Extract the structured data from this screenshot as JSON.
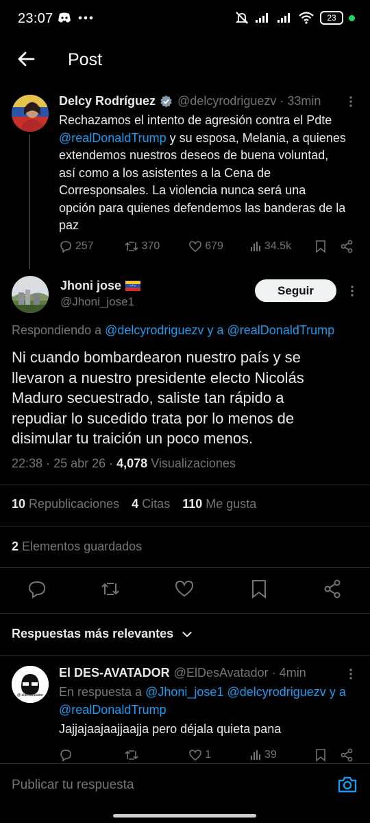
{
  "status_bar": {
    "time": "23:07",
    "battery": "23"
  },
  "header": {
    "title": "Post"
  },
  "parent_tweet": {
    "name": "Delcy Rodríguez",
    "handle": "@delcyrodriguezv",
    "time": "· 33min",
    "text_lines": [
      "Rechazamos el intento de agresión contra el Pdte",
      "@realDonaldTrump",
      " y su esposa, Melania, a quienes",
      "extendemos nuestros deseos de buena voluntad,",
      "así como a los asistentes a la Cena de",
      "Corresponsales. La violencia nunca será una",
      "opción para quienes defendemos las banderas de la",
      "paz"
    ],
    "replies": "257",
    "retweets": "370",
    "likes": "679",
    "views": "34.5k"
  },
  "main_tweet": {
    "name": "Jhoni jose",
    "handle": "@Jhoni_jose1",
    "follow_label": "Seguir",
    "replying_prefix": "Respondiendo a",
    "replying_user1": "@delcyrodriguezv",
    "replying_and": "y a",
    "replying_user2": "@realDonaldTrump",
    "text_lines": [
      "Ni cuando bombardearon nuestro país y se",
      "llevaron a nuestro presidente electo Nicolás",
      "Maduro secuestrado, saliste tan rápido a",
      "repudiar lo sucedido trata por lo menos de",
      "disimular tu traición un poco menos."
    ],
    "time": "22:38",
    "date": "25 abr 26",
    "views_count": "4,078",
    "views_label": "Visualizaciones",
    "reposts_count": "10",
    "reposts_label": "Republicaciones",
    "quotes_count": "4",
    "quotes_label": "Citas",
    "likes_count": "110",
    "likes_label": "Me gusta",
    "bookmarks_count": "2",
    "bookmarks_label": "Elementos guardados"
  },
  "sort": {
    "label": "Respuestas más relevantes"
  },
  "reply": {
    "name": "El DES-AVATADOR",
    "handle": "@ElDesAvatador",
    "time": "· 4min",
    "in_reply_prefix": "En respuesta a",
    "in_reply_user1": "@Jhoni_jose1",
    "in_reply_user2": "@delcyrodriguezv",
    "in_reply_and": "y a",
    "in_reply_user3": "@realDonaldTrump",
    "text": "Jajjajaajaajjaajja pero déjala quieta pana",
    "avatar_text": "@ eldesavatador",
    "likes": "1",
    "views": "39"
  },
  "composer": {
    "placeholder": "Publicar tu respuesta"
  },
  "colors": {
    "background": "#000000",
    "link": "#1d9bf0",
    "secondary_text": "#71767b",
    "verified": "#829aab"
  }
}
